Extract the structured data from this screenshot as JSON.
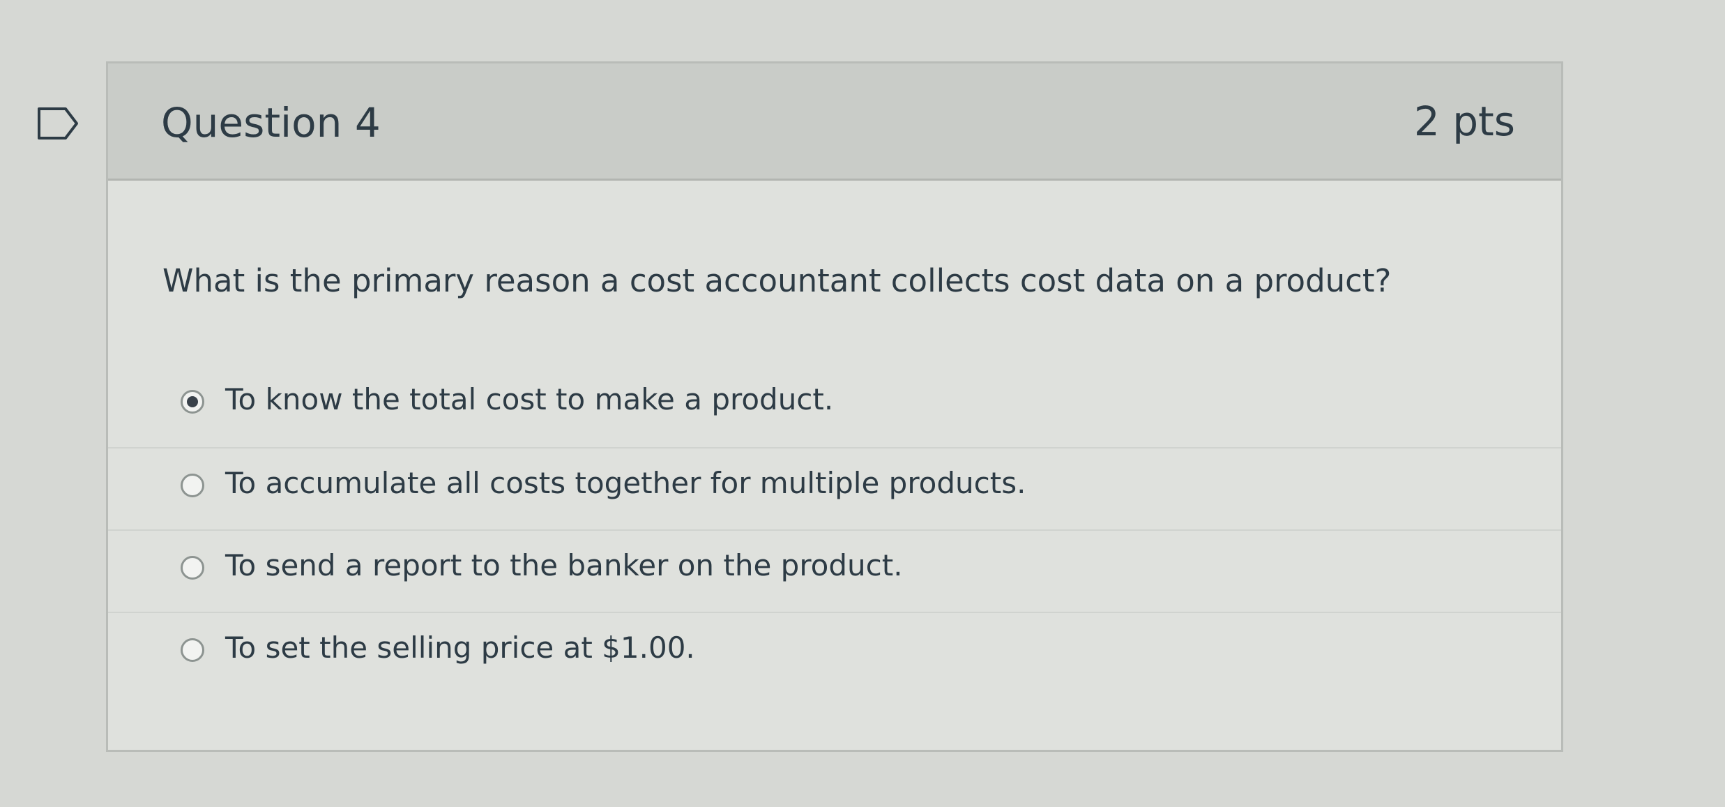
{
  "question": {
    "title": "Question 4",
    "points": "2 pts",
    "text": "What is the primary reason a cost accountant collects cost data on a product?"
  },
  "answers": [
    {
      "label": "To know the total cost to make a product.",
      "selected": true
    },
    {
      "label": "To accumulate all costs together for multiple products.",
      "selected": false
    },
    {
      "label": "To send a report to the banker on the product.",
      "selected": false
    },
    {
      "label": "To set the selling price at $1.00.",
      "selected": false
    }
  ],
  "icons": {
    "flag": "flag-question-icon"
  },
  "colors": {
    "text": "#2d3b45",
    "header_bg": "#c9ccc8",
    "card_bg": "#dfe1dd",
    "border": "#b9bcb8",
    "selected_dot": "#39414a"
  }
}
